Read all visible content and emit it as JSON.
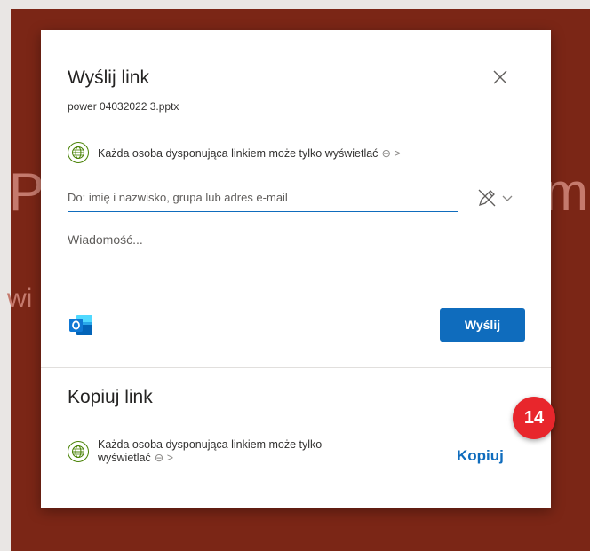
{
  "background": {
    "text_left": "P",
    "text_right": "m",
    "text_second": "wi"
  },
  "dialog": {
    "title": "Wyślij link",
    "filename": "power 04032022 3.pptx",
    "permission": {
      "text": "Każda osoba dysponująca linkiem może tylko wyświetlać",
      "suffix": "⊖ >"
    },
    "to_field": {
      "placeholder": "Do: imię i nazwisko, grupa lub adres e-mail"
    },
    "message_placeholder": "Wiadomość...",
    "send_label": "Wyślij",
    "copy_section": {
      "title": "Kopiuj link",
      "permission_text": "Każda osoba dysponująca linkiem może tylko wyświetlać",
      "permission_suffix": "⊖ >",
      "copy_label": "Kopiuj"
    }
  },
  "annotation_badge": "14",
  "colors": {
    "background": "#7b2616",
    "accent": "#0f6cbd",
    "globe_green": "#498205",
    "badge_red": "#e8262c"
  },
  "icons": [
    "globe-icon",
    "close-icon",
    "pen-icon",
    "chevron-down-icon",
    "outlook-icon"
  ]
}
